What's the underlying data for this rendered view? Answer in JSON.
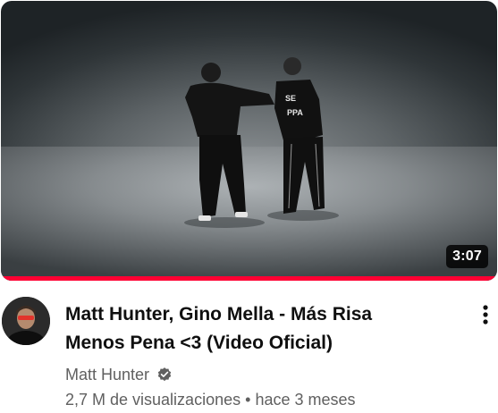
{
  "video": {
    "title": "Matt Hunter, Gino Mella - Más Risa Menos Pena <3 (Video Oficial)",
    "duration": "3:07",
    "watch_progress": 1.0
  },
  "channel": {
    "name": "Matt Hunter",
    "verified_icon": "verified-check-icon"
  },
  "meta": {
    "views": "2,7 M de visualizaciones",
    "separator": "•",
    "age": "hace 3 meses"
  },
  "menu": {
    "icon": "more-vert-icon"
  },
  "colors": {
    "progress": "#ff0033",
    "title": "#0f0f0f",
    "secondary_text": "#606060"
  }
}
